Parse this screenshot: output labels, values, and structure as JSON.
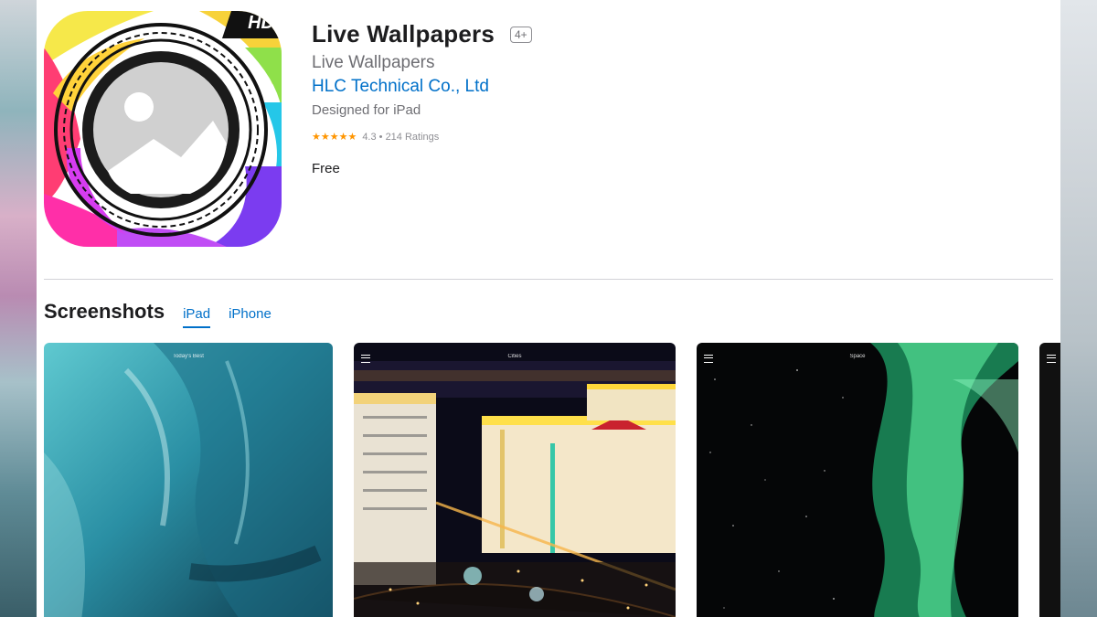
{
  "app": {
    "title": "Live Wallpapers",
    "age_rating": "4+",
    "subtitle": "Live Wallpapers",
    "developer": "HLC Technical Co., Ltd",
    "designed_for": "Designed for iPad",
    "rating_stars": "★★★★★",
    "rating_text": "4.3 • 214 Ratings",
    "price": "Free",
    "icon_badge": "HD"
  },
  "screenshots": {
    "heading": "Screenshots",
    "tabs": [
      {
        "label": "iPad",
        "active": true
      },
      {
        "label": "iPhone",
        "active": false
      }
    ],
    "items": [
      {
        "label": "Today's Best"
      },
      {
        "label": "Cities"
      },
      {
        "label": "Space"
      }
    ]
  },
  "colors": {
    "link": "#0070c9",
    "star": "#ff9500"
  }
}
